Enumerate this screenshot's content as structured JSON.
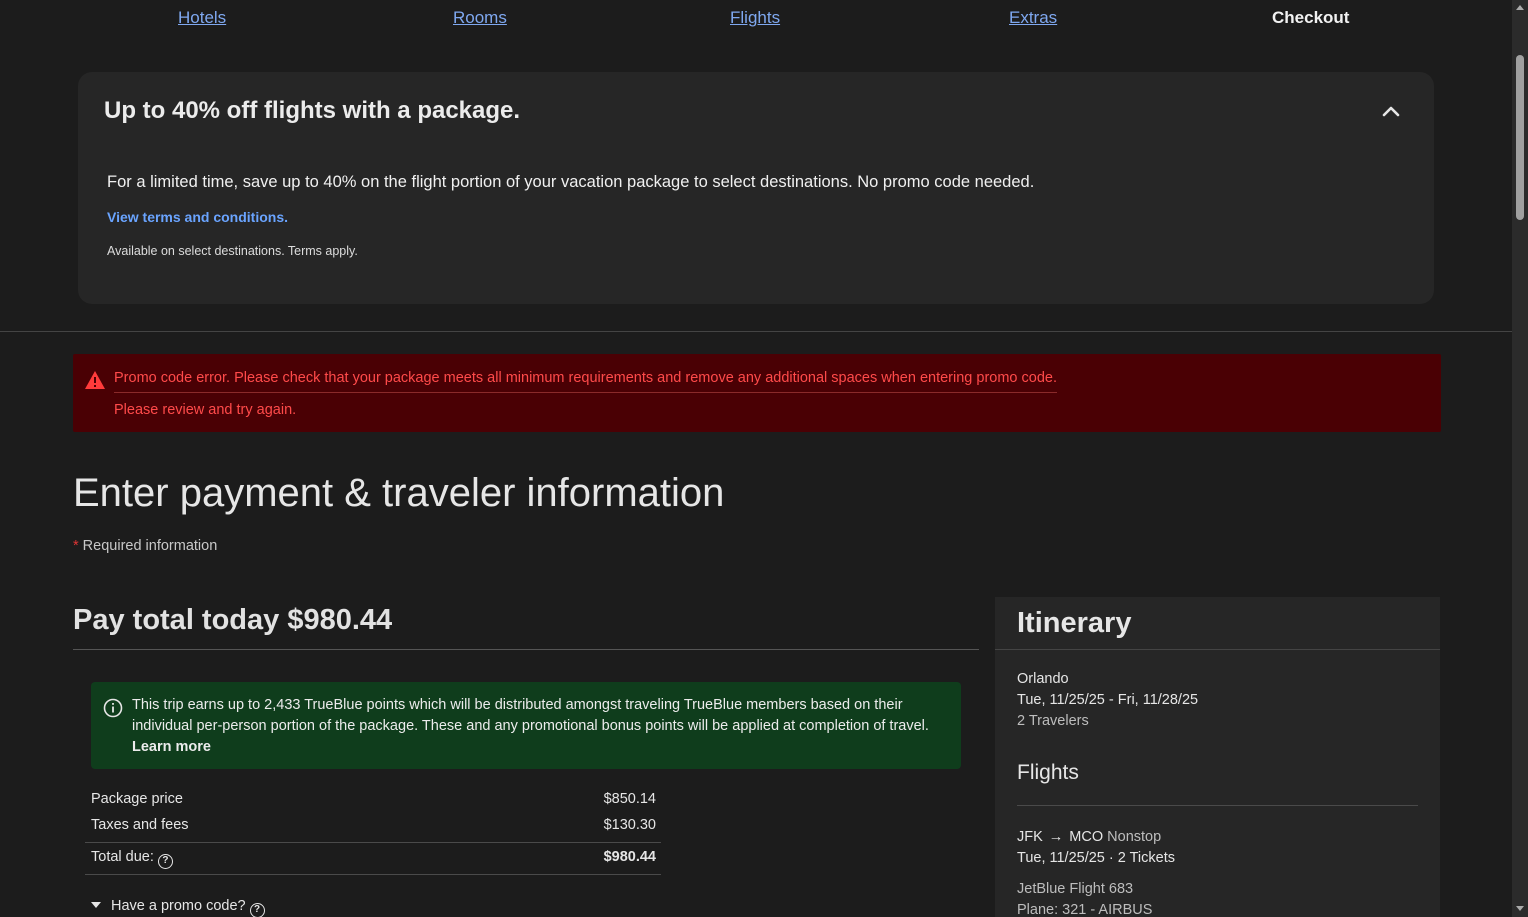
{
  "nav": {
    "hotels": "Hotels",
    "rooms": "Rooms",
    "flights": "Flights",
    "extras": "Extras",
    "checkout": "Checkout"
  },
  "promo": {
    "title": "Up to 40% off flights with a package.",
    "body": "For a limited time, save up to 40% on the flight portion of your vacation package to select destinations.  No promo code needed.",
    "terms_link": "View terms and conditions.",
    "note": "Available on select destinations. Terms apply."
  },
  "error": {
    "line1": "Promo code error. Please check that your package meets all minimum requirements and remove any additional spaces when entering promo code.",
    "line2": "Please review and try again."
  },
  "page": {
    "title": "Enter payment & traveler information",
    "required_star": "*",
    "required": " Required information"
  },
  "payment": {
    "title": "Pay total today $980.44",
    "points_text": "This trip earns up to 2,433 TrueBlue points which will be distributed amongst traveling TrueBlue members based on their individual per-person portion of the package. These and any promotional bonus points will be applied at completion of travel.",
    "learn_more": "Learn more",
    "package_label": "Package price",
    "package_value": "$850.14",
    "taxes_label": "Taxes and fees",
    "taxes_value": "$130.30",
    "total_label": "Total due:",
    "total_value": "$980.44",
    "promo_toggle": "Have a promo code?"
  },
  "itinerary": {
    "title": "Itinerary",
    "city": "Orlando",
    "dates": "Tue, 11/25/25 - Fri, 11/28/25",
    "travelers": "2 Travelers",
    "flights_heading": "Flights",
    "origin": "JFK",
    "destination": "MCO",
    "stops": "Nonstop",
    "flight_date": "Tue, 11/25/25 · 2 Tickets",
    "flight_number": "JetBlue Flight 683",
    "plane": "Plane: 321 - AIRBUS"
  },
  "colors": {
    "link": "#7fa8f0",
    "error_bg": "#4a0004",
    "error_text": "#ff4a4a",
    "points_bg": "#0f3d1c"
  }
}
